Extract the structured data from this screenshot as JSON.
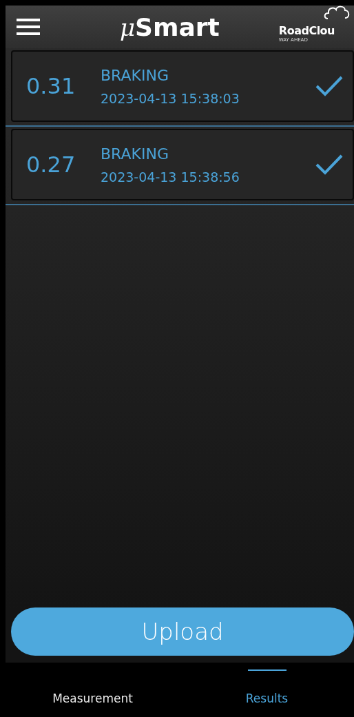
{
  "header": {
    "title_prefix": "μ",
    "title": "Smart",
    "brand": "RoadClou",
    "tagline": "WAY AHEAD"
  },
  "results": [
    {
      "value": "0.31",
      "type": "BRAKING",
      "timestamp": "2023-04-13 15:38:03",
      "checked": true
    },
    {
      "value": "0.27",
      "type": "BRAKING",
      "timestamp": "2023-04-13 15:38:56",
      "checked": true
    }
  ],
  "upload_button": "Upload",
  "tabs": [
    {
      "label": "Measurement",
      "selected": false
    },
    {
      "label": "Results",
      "selected": true
    }
  ]
}
